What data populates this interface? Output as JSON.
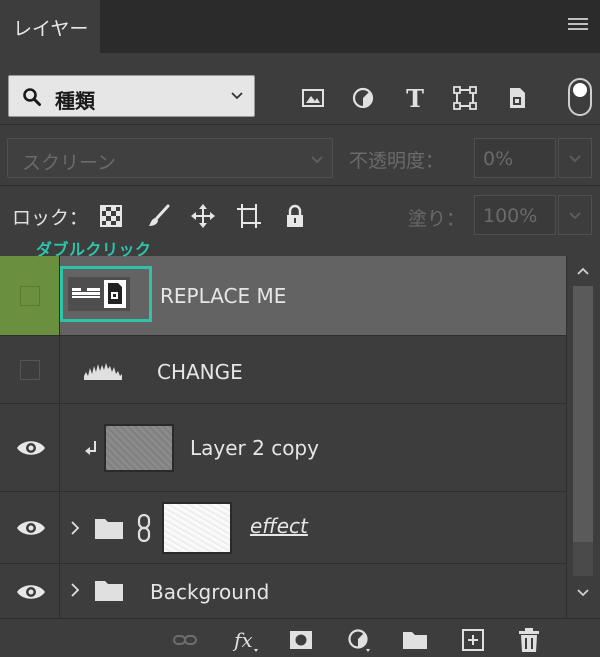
{
  "panel": {
    "tab_label": "レイヤー"
  },
  "filter": {
    "kind_label": "種類"
  },
  "blend": {
    "mode": "スクリーン",
    "opacity_label": "不透明度：",
    "opacity_value": "0%"
  },
  "lock": {
    "label": "ロック：",
    "fill_label": "塗り：",
    "fill_value": "100%"
  },
  "annotation": {
    "text": "ダブルクリック",
    "color": "#2ec4a9"
  },
  "layers": [
    {
      "name": "REPLACE ME",
      "visible": false,
      "selected": true,
      "type": "smart-object"
    },
    {
      "name": "CHANGE",
      "visible": false,
      "selected": false,
      "type": "adjustment"
    },
    {
      "name": "Layer 2 copy",
      "visible": true,
      "selected": false,
      "type": "clipped-raster"
    },
    {
      "name": "effect",
      "visible": true,
      "selected": false,
      "type": "group-with-mask"
    },
    {
      "name": "Background",
      "visible": true,
      "selected": false,
      "type": "group"
    }
  ],
  "colors": {
    "panel_bg": "#3d3d3d",
    "selected_row": "#636363",
    "visibility_selected": "#6a8f3e"
  }
}
